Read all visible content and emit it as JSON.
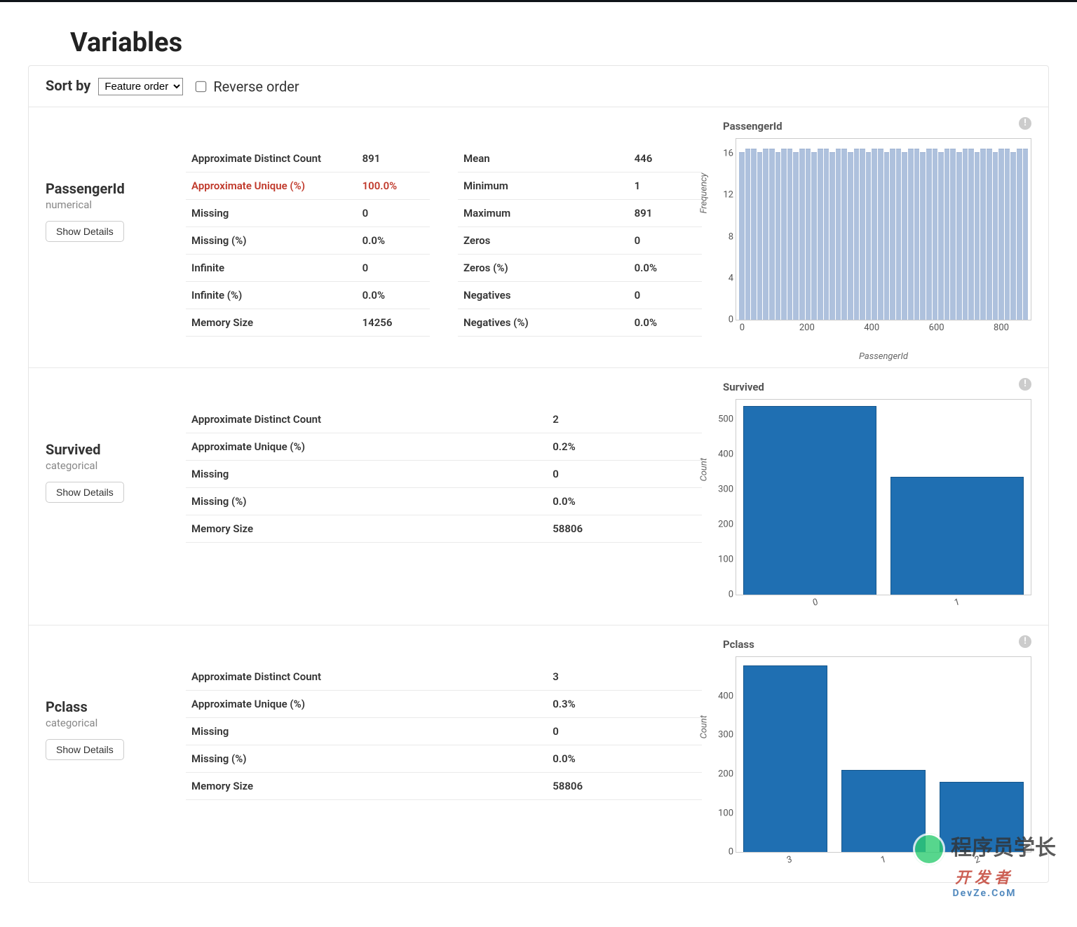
{
  "title": "Variables",
  "sortbar": {
    "label": "Sort by",
    "select_value": "Feature order",
    "reverse_label": "Reverse order",
    "reverse_checked": false
  },
  "show_details_label": "Show Details",
  "variables": [
    {
      "name": "PassengerId",
      "type": "numerical",
      "stats_left": [
        {
          "label": "Approximate Distinct Count",
          "value": "891",
          "highlight": false
        },
        {
          "label": "Approximate Unique (%)",
          "value": "100.0%",
          "highlight": true
        },
        {
          "label": "Missing",
          "value": "0",
          "highlight": false
        },
        {
          "label": "Missing (%)",
          "value": "0.0%",
          "highlight": false
        },
        {
          "label": "Infinite",
          "value": "0",
          "highlight": false
        },
        {
          "label": "Infinite (%)",
          "value": "0.0%",
          "highlight": false
        },
        {
          "label": "Memory Size",
          "value": "14256",
          "highlight": false
        }
      ],
      "stats_right": [
        {
          "label": "Mean",
          "value": "446"
        },
        {
          "label": "Minimum",
          "value": "1"
        },
        {
          "label": "Maximum",
          "value": "891"
        },
        {
          "label": "Zeros",
          "value": "0"
        },
        {
          "label": "Zeros (%)",
          "value": "0.0%"
        },
        {
          "label": "Negatives",
          "value": "0"
        },
        {
          "label": "Negatives (%)",
          "value": "0.0%"
        }
      ],
      "chart": {
        "title": "PassengerId",
        "ylabel": "Frequency",
        "xlabel": "PassengerId",
        "type": "histogram-uniform",
        "y_ticks": [
          "0",
          "4",
          "8",
          "12",
          "16"
        ],
        "x_ticks": [
          "0",
          "200",
          "400",
          "600",
          "800"
        ]
      }
    },
    {
      "name": "Survived",
      "type": "categorical",
      "stats_left": [
        {
          "label": "Approximate Distinct Count",
          "value": "2"
        },
        {
          "label": "Approximate Unique (%)",
          "value": "0.2%"
        },
        {
          "label": "Missing",
          "value": "0"
        },
        {
          "label": "Missing (%)",
          "value": "0.0%"
        },
        {
          "label": "Memory Size",
          "value": "58806"
        }
      ],
      "stats_right": [],
      "chart": {
        "title": "Survived",
        "ylabel": "Count",
        "xlabel": "",
        "type": "bar",
        "y_ticks": [
          "0",
          "100",
          "200",
          "300",
          "400",
          "500"
        ],
        "x_ticks": [
          "0",
          "1"
        ]
      }
    },
    {
      "name": "Pclass",
      "type": "categorical",
      "stats_left": [
        {
          "label": "Approximate Distinct Count",
          "value": "3"
        },
        {
          "label": "Approximate Unique (%)",
          "value": "0.3%"
        },
        {
          "label": "Missing",
          "value": "0"
        },
        {
          "label": "Missing (%)",
          "value": "0.0%"
        },
        {
          "label": "Memory Size",
          "value": "58806"
        }
      ],
      "stats_right": [],
      "chart": {
        "title": "Pclass",
        "ylabel": "Count",
        "xlabel": "",
        "type": "bar",
        "y_ticks": [
          "0",
          "100",
          "200",
          "300",
          "400"
        ],
        "x_ticks": [
          "3",
          "1",
          "2"
        ]
      }
    }
  ],
  "chart_data": [
    {
      "variable": "PassengerId",
      "type": "bar",
      "title": "PassengerId",
      "xlabel": "PassengerId",
      "ylabel": "Frequency",
      "ylim": [
        0,
        18
      ],
      "note": "uniform histogram, ~50 bins from 1 to 891, each ~18",
      "categories": "bins 0..891",
      "values_approx": 18
    },
    {
      "variable": "Survived",
      "type": "bar",
      "title": "Survived",
      "xlabel": "",
      "ylabel": "Count",
      "ylim": [
        0,
        550
      ],
      "categories": [
        "0",
        "1"
      ],
      "values": [
        549,
        342
      ]
    },
    {
      "variable": "Pclass",
      "type": "bar",
      "title": "Pclass",
      "xlabel": "",
      "ylabel": "Count",
      "ylim": [
        0,
        500
      ],
      "categories": [
        "3",
        "1",
        "2"
      ],
      "values": [
        491,
        216,
        184
      ]
    }
  ],
  "watermark": {
    "line1": "程序员学长",
    "line2": "开发者",
    "site": "DevZe.CoM"
  }
}
